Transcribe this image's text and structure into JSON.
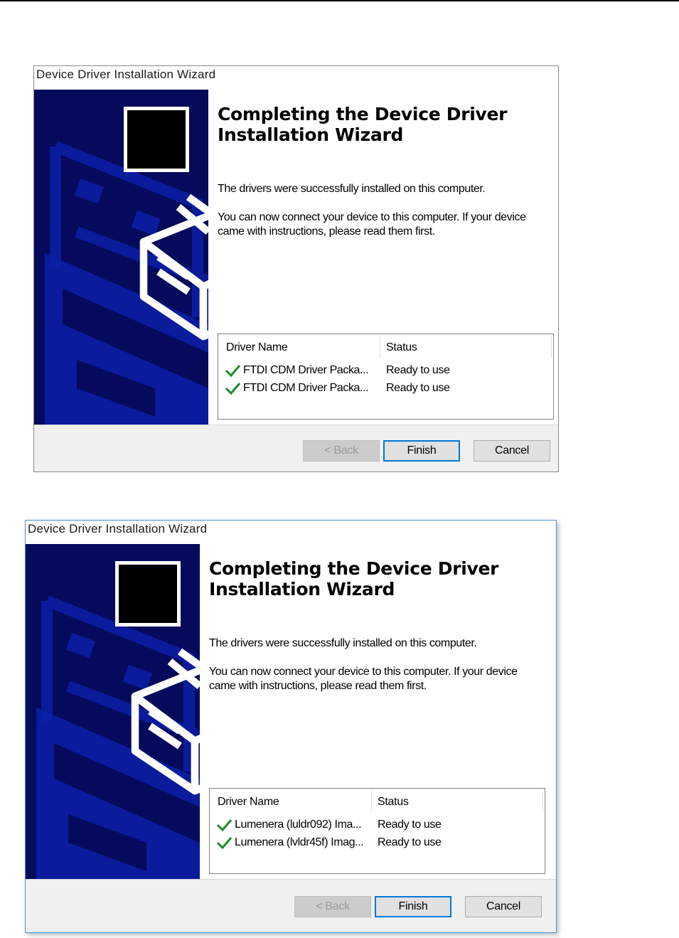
{
  "wizards": [
    {
      "title": "Device Driver Installation Wizard",
      "heading": "Completing the Device Driver Installation Wizard",
      "message_1": "The drivers were successfully installed on this computer.",
      "message_2": "You can now connect your device to this computer. If your device came with instructions, please read them first.",
      "columns": {
        "name": "Driver Name",
        "status": "Status"
      },
      "drivers": [
        {
          "name": "FTDI CDM Driver Packa...",
          "status": "Ready to use"
        },
        {
          "name": "FTDI CDM Driver Packa...",
          "status": "Ready to use"
        }
      ],
      "buttons": {
        "back": "< Back",
        "finish": "Finish",
        "cancel": "Cancel"
      }
    },
    {
      "title": "Device Driver Installation Wizard",
      "heading": "Completing the Device Driver Installation Wizard",
      "message_1": "The drivers were successfully installed on this computer.",
      "message_2": "You can now connect your device to this computer. If your device came with instructions, please read them first.",
      "columns": {
        "name": "Driver Name",
        "status": "Status"
      },
      "drivers": [
        {
          "name": "Lumenera (luldr092) Ima...",
          "status": "Ready to use"
        },
        {
          "name": "Lumenera (lvldr45f) Imag...",
          "status": "Ready to use"
        }
      ],
      "buttons": {
        "back": "< Back",
        "finish": "Finish",
        "cancel": "Cancel"
      }
    }
  ],
  "colors": {
    "banner": "#050a5c",
    "banner_shape": "#0c1fa8",
    "check": "#1f8a2a",
    "focus_border": "#0078d7"
  },
  "icons": {
    "wizard_logo": "hardware-install-icon",
    "row_status": "checkmark-icon"
  }
}
